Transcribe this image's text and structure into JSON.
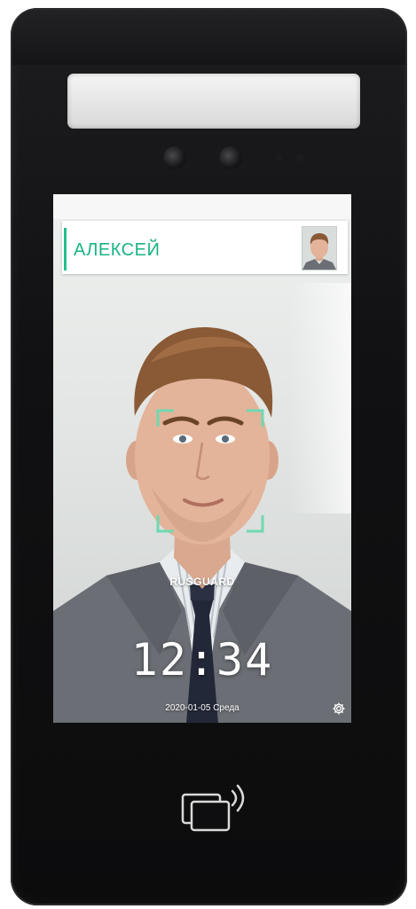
{
  "recognition": {
    "person_name": "АЛЕКСЕЙ"
  },
  "brand": {
    "logo_text": "RUSGUARD"
  },
  "clock": {
    "time": "12:34",
    "date_line": "2020-01-05 Среда"
  },
  "icons": {
    "settings": "gear-icon",
    "card_reader": "nfc-card-icon",
    "face_frame": "face-detection-frame"
  },
  "colors": {
    "accent_green": "#1fbf8f",
    "device_body": "#111113"
  }
}
